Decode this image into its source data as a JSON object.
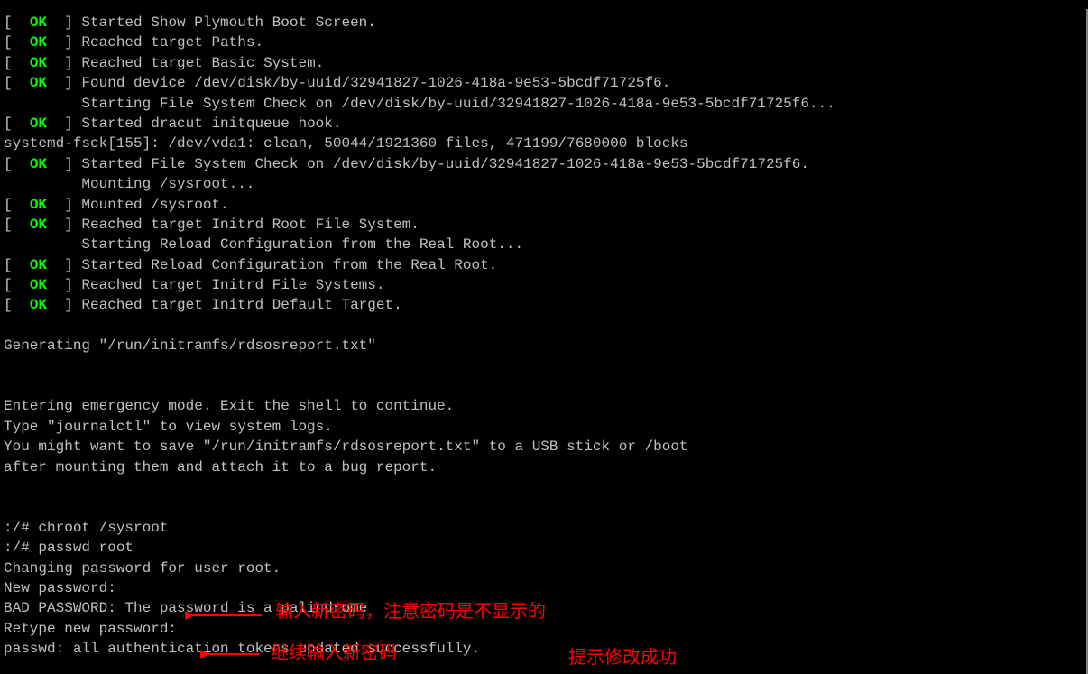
{
  "top_caption_fragment": "",
  "lines": [
    {
      "type": "status",
      "status": "OK",
      "text": "Started Show Plymouth Boot Screen."
    },
    {
      "type": "status",
      "status": "OK",
      "text": "Reached target Paths."
    },
    {
      "type": "status",
      "status": "OK",
      "text": "Reached target Basic System."
    },
    {
      "type": "status",
      "status": "OK",
      "text": "Found device /dev/disk/by-uuid/32941827-1026-418a-9e53-5bcdf71725f6."
    },
    {
      "type": "plain",
      "prefix": "         ",
      "text": "Starting File System Check on /dev/disk/by-uuid/32941827-1026-418a-9e53-5bcdf71725f6..."
    },
    {
      "type": "status",
      "status": "OK",
      "text": "Started dracut initqueue hook."
    },
    {
      "type": "plain",
      "prefix": "",
      "text": "systemd-fsck[155]: /dev/vda1: clean, 50044/1921360 files, 471199/7680000 blocks"
    },
    {
      "type": "status",
      "status": "OK",
      "text": "Started File System Check on /dev/disk/by-uuid/32941827-1026-418a-9e53-5bcdf71725f6."
    },
    {
      "type": "plain",
      "prefix": "         ",
      "text": "Mounting /sysroot..."
    },
    {
      "type": "status",
      "status": "OK",
      "text": "Mounted /sysroot."
    },
    {
      "type": "status",
      "status": "OK",
      "text": "Reached target Initrd Root File System."
    },
    {
      "type": "plain",
      "prefix": "         ",
      "text": "Starting Reload Configuration from the Real Root..."
    },
    {
      "type": "status",
      "status": "OK",
      "text": "Started Reload Configuration from the Real Root."
    },
    {
      "type": "status",
      "status": "OK",
      "text": "Reached target Initrd File Systems."
    },
    {
      "type": "status",
      "status": "OK",
      "text": "Reached target Initrd Default Target."
    },
    {
      "type": "plain",
      "prefix": "",
      "text": ""
    },
    {
      "type": "plain",
      "prefix": "",
      "text": "Generating \"/run/initramfs/rdsosreport.txt\""
    },
    {
      "type": "plain",
      "prefix": "",
      "text": ""
    },
    {
      "type": "plain",
      "prefix": "",
      "text": ""
    },
    {
      "type": "plain",
      "prefix": "",
      "text": "Entering emergency mode. Exit the shell to continue."
    },
    {
      "type": "plain",
      "prefix": "",
      "text": "Type \"journalctl\" to view system logs."
    },
    {
      "type": "plain",
      "prefix": "",
      "text": "You might want to save \"/run/initramfs/rdsosreport.txt\" to a USB stick or /boot"
    },
    {
      "type": "plain",
      "prefix": "",
      "text": "after mounting them and attach it to a bug report."
    },
    {
      "type": "plain",
      "prefix": "",
      "text": ""
    },
    {
      "type": "plain",
      "prefix": "",
      "text": ""
    },
    {
      "type": "plain",
      "prefix": "",
      "text": ":/# chroot /sysroot"
    },
    {
      "type": "plain",
      "prefix": "",
      "text": ":/# passwd root"
    },
    {
      "type": "plain",
      "prefix": "",
      "text": "Changing password for user root."
    },
    {
      "type": "plain",
      "prefix": "",
      "text": "New password:"
    },
    {
      "type": "plain",
      "prefix": "",
      "text": "BAD PASSWORD: The password is a palindrome"
    },
    {
      "type": "plain",
      "prefix": "",
      "text": "Retype new password:"
    },
    {
      "type": "plain",
      "prefix": "",
      "text": "passwd: all authentication tokens updated successfully."
    }
  ],
  "annotations": {
    "a1": "输入新密码，注意密码是不显示的",
    "a2": "继续输入新密码",
    "a3": "提示修改成功"
  },
  "bracket_open": "[  ",
  "bracket_close": "  ] "
}
